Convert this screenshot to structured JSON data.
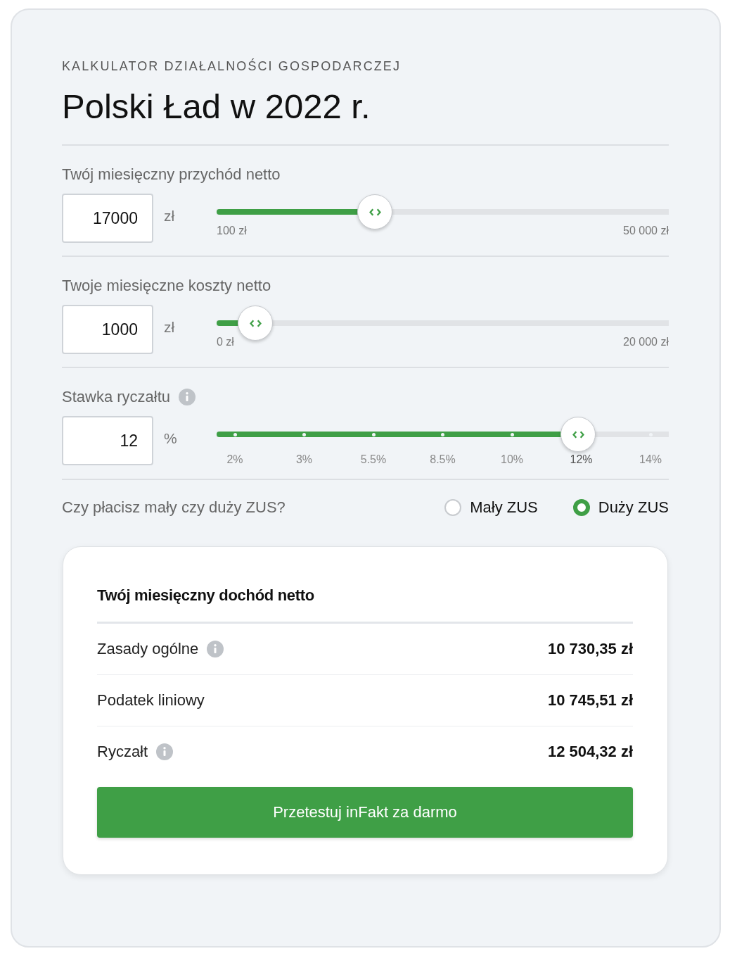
{
  "eyebrow": "KALKULATOR DZIAŁALNOŚCI GOSPODARCZEJ",
  "title": "Polski Ład w 2022 r.",
  "sliders": [
    {
      "kind": "range",
      "label": "Twój miesięczny przychód netto",
      "info": false,
      "value": "17000",
      "unit": "zł",
      "level": 0.35,
      "min_label": "100 zł",
      "max_label": "50 000 zł"
    },
    {
      "kind": "range",
      "label": "Twoje miesięczne koszty netto",
      "info": false,
      "value": "1000",
      "unit": "zł",
      "level": 0.086,
      "min_label": "0 zł",
      "max_label": "20 000 zł"
    },
    {
      "kind": "steps",
      "label": "Stawka ryczałtu",
      "info": true,
      "value": "12",
      "unit": "%",
      "level": 0.8,
      "ticks": [
        {
          "label": "2%",
          "selected": false
        },
        {
          "label": "3%",
          "selected": false
        },
        {
          "label": "5.5%",
          "selected": false
        },
        {
          "label": "8.5%",
          "selected": false
        },
        {
          "label": "10%",
          "selected": false
        },
        {
          "label": "12%",
          "selected": true
        },
        {
          "label": "14%",
          "selected": false
        }
      ]
    }
  ],
  "zus": {
    "question": "Czy płacisz mały czy duży ZUS?",
    "options": [
      {
        "label": "Mały ZUS",
        "selected": false
      },
      {
        "label": "Duży ZUS",
        "selected": true
      }
    ]
  },
  "result": {
    "heading": "Twój miesięczny dochód netto",
    "rows": [
      {
        "label": "Zasady ogólne",
        "info": true,
        "amount": "10 730,35 zł"
      },
      {
        "label": "Podatek liniowy",
        "info": false,
        "amount": "10 745,51 zł"
      },
      {
        "label": "Ryczałt",
        "info": true,
        "amount": "12 504,32 zł"
      }
    ],
    "button": "Przetestuj inFakt za darmo"
  }
}
